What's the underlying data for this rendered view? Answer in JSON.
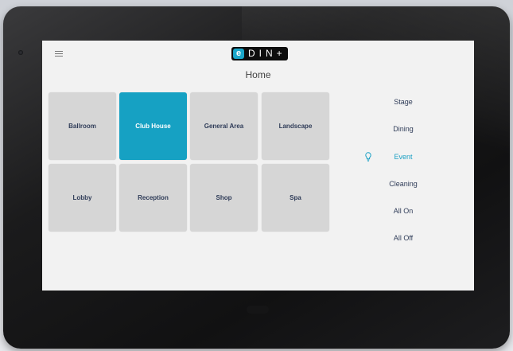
{
  "brand": {
    "mark": "e",
    "name": "DIN+"
  },
  "header": {
    "title": "Home"
  },
  "rooms": [
    {
      "label": "Ballroom",
      "active": false
    },
    {
      "label": "Club House",
      "active": true
    },
    {
      "label": "General Area",
      "active": false
    },
    {
      "label": "Landscape",
      "active": false
    },
    {
      "label": "Lobby",
      "active": false
    },
    {
      "label": "Reception",
      "active": false
    },
    {
      "label": "Shop",
      "active": false
    },
    {
      "label": "Spa",
      "active": false
    }
  ],
  "scenes": [
    {
      "label": "Stage",
      "active": false
    },
    {
      "label": "Dining",
      "active": false
    },
    {
      "label": "Event",
      "active": true
    },
    {
      "label": "Cleaning",
      "active": false
    },
    {
      "label": "All On",
      "active": false
    },
    {
      "label": "All Off",
      "active": false
    }
  ],
  "colors": {
    "accent": "#16a1c3",
    "tile_bg": "#d6d6d6",
    "label_text": "#2f3c58",
    "screen_bg": "#f2f2f2",
    "bezel": "#1b1b1c"
  },
  "icons": {
    "menu": "menu-icon",
    "active_scene": "lightbulb-icon"
  }
}
